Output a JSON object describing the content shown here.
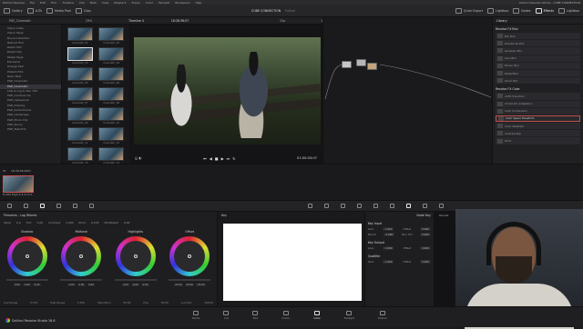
{
  "window": {
    "title": "DaVinci Resolve Studio - CUBE CONNECTION"
  },
  "menu": [
    "DaVinci Resolve",
    "File",
    "Edit",
    "Trim",
    "Timeline",
    "Clip",
    "Mark",
    "View",
    "Playback",
    "Fusion",
    "Color",
    "Fairlight",
    "Workspace",
    "Help"
  ],
  "toolbar": {
    "left": [
      "Gallery",
      "LUTs",
      "Media Pool",
      "Clips"
    ],
    "center_title": "CUBE CONNECTION",
    "center_sub": "Edited",
    "right": [
      "Quick Export",
      "Lightbox",
      "Nodes",
      "Effects",
      "Lightbox"
    ]
  },
  "subbar": {
    "folder": "PGE_Cinematic",
    "zoom": "29%",
    "timeline_label": "Timeline 4",
    "timecode_top": "18:28:36:07",
    "clip_label": "Clip",
    "library_tab": "Library",
    "settings_tab": "Settings"
  },
  "left_list": [
    "Vision Cube",
    "Vision Style",
    "Bryce Collection",
    "Natural Film",
    "Reach Film",
    "Bright City",
    "Pastel Style",
    "Elements",
    "Orange Teal",
    "Pinkish Film",
    "Retro Mist",
    "PGE_Cinematic",
    "PGE_Cinematic",
    "LOG & Log to Rec 709",
    "PGE_Commercial",
    "PGE_Cyberpunk",
    "PGE_Dreamy",
    "PGE_Kodachrome",
    "PGE_Landscape",
    "PGE_Moon City",
    "PGE_Sunny",
    "PGE_Teal Pink"
  ],
  "thumb_labels": [
    "Cinematic_01",
    "Cinematic_02",
    "Cinematic_03",
    "Cinematic_04",
    "Cinematic_05",
    "Cinematic_06",
    "Cinematic_07",
    "Cinematic_08",
    "Cinematic_09",
    "Cinematic_10",
    "Cinematic_11",
    "Cinematic_12",
    "Cinematic_13",
    "Cinematic_14",
    "Cinematic_15",
    "Cinematic_16"
  ],
  "viewer": {
    "timecode": "01:00:03:07"
  },
  "library": {
    "section_blur": "Resolve FX Blur",
    "blur_items": [
      "Box Blur",
      "Directional Blur",
      "Gaussian Blur",
      "Lens Blur",
      "Mosaic Blur",
      "Radial Blur",
      "Zoom Blur"
    ],
    "section_color": "Resolve FX Color",
    "color_items": [
      "ACES Transform",
      "Chromatic Adaptation",
      "Color Compressor",
      "Color Space Transform",
      "Color Stabilizer",
      "Contrast Pop",
      "DCTL"
    ],
    "highlighted_item": "Color Space Transform"
  },
  "clip": {
    "timecode": "18:28:36:00",
    "codec": "H.264 High 4:2:2 L5.1",
    "index": "01",
    "track": "V1"
  },
  "color_panel": {
    "title": "Primaries - Log Wheels",
    "params": [
      "Temp",
      "0.0",
      "Tint",
      "0.00",
      "Contrast",
      "1.000",
      "Pivot",
      "0.435",
      "Mid/Detail",
      "0.00"
    ],
    "wheels": [
      {
        "name": "Shadow",
        "values": [
          "0.00",
          "0.00",
          "0.00"
        ]
      },
      {
        "name": "Midtone",
        "values": [
          "0.00",
          "0.00",
          "0.00"
        ]
      },
      {
        "name": "Highlights",
        "values": [
          "0.00",
          "0.00",
          "0.00"
        ]
      },
      {
        "name": "Offset",
        "values": [
          "25.00",
          "25.00",
          "25.00"
        ]
      }
    ],
    "footer": [
      "Low Range",
      "0.333",
      "High Range",
      "0.550",
      "Saturation",
      "50.00",
      "Hue",
      "50.00",
      "Lum Mix",
      "100.00"
    ]
  },
  "key": {
    "title": "Key",
    "panel_title": "Node Key",
    "key_input": "Key Input",
    "key_output": "Key Output",
    "qualifier": "Qualifier",
    "gain_label": "Gain",
    "gain_value": "1.000",
    "offset_label": "Offset",
    "offset_value": "0.000",
    "blur_label": "Blur R.",
    "blur_value": "0.000",
    "blur_h_label": "Blur H/V",
    "blur_h_value": "0.000"
  },
  "scopes": {
    "title": "Parade",
    "label_right": "Waveform"
  },
  "pages": [
    "Media",
    "Cut",
    "Edit",
    "Fusion",
    "Color",
    "Fairlight",
    "Deliver"
  ],
  "active_page": "Color",
  "brand": "DaVinci Resolve Studio 18.6"
}
